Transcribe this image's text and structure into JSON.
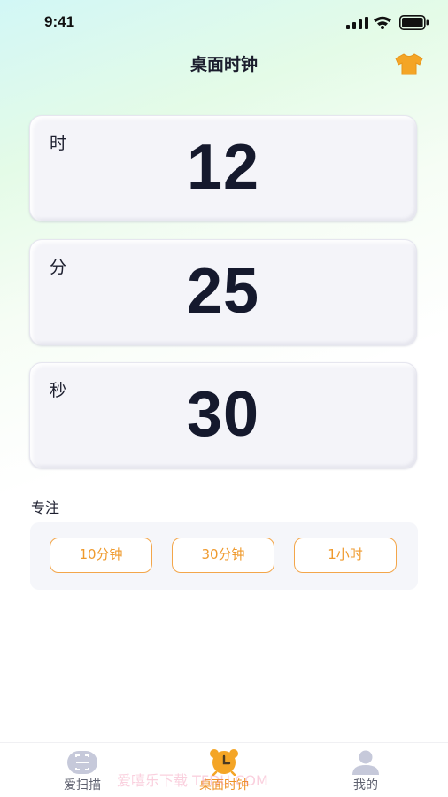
{
  "status_bar": {
    "time": "9:41"
  },
  "nav": {
    "title": "桌面时钟",
    "theme_icon": "tshirt-icon"
  },
  "clock": [
    {
      "label": "时",
      "value": "12"
    },
    {
      "label": "分",
      "value": "25"
    },
    {
      "label": "秒",
      "value": "30"
    }
  ],
  "focus": {
    "title": "专注",
    "options": [
      "10分钟",
      "30分钟",
      "1小时"
    ]
  },
  "tabs": [
    {
      "label": "爱扫描",
      "icon": "scan-icon",
      "active": false
    },
    {
      "label": "桌面时钟",
      "icon": "alarm-clock-icon",
      "active": true
    },
    {
      "label": "我的",
      "icon": "user-icon",
      "active": false
    }
  ],
  "watermark": "爱嘻乐下载 TFDU.COM",
  "colors": {
    "accent": "#f3a64a",
    "digits": "#15192d",
    "card_bg": "#f4f4f9"
  }
}
